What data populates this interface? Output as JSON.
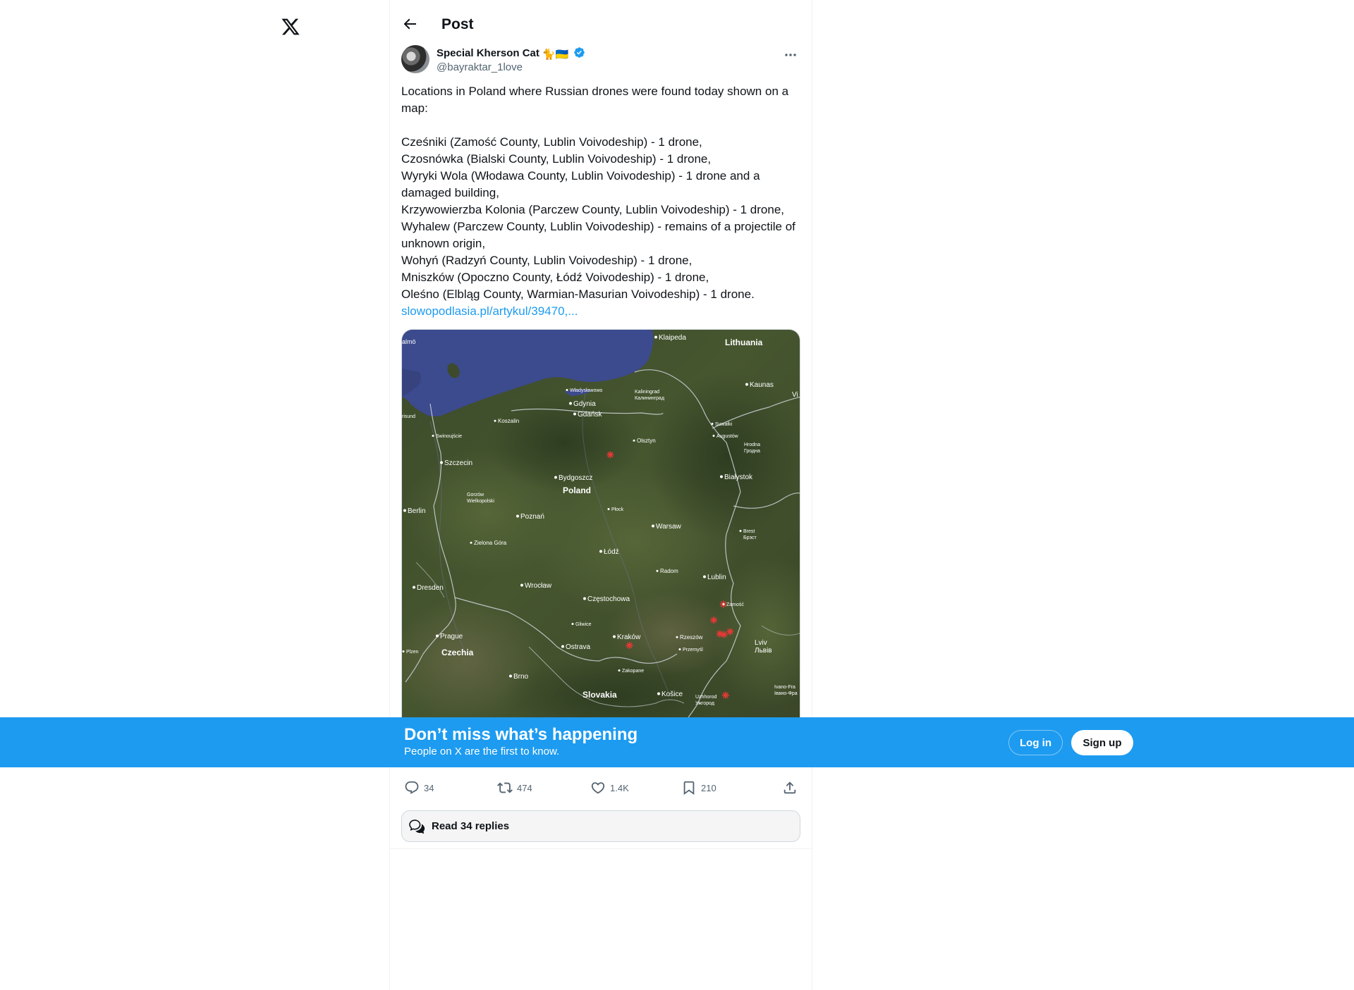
{
  "header": {
    "title": "Post"
  },
  "author": {
    "display_name": "Special Kherson Cat",
    "name_emoji": "🐈🇺🇦",
    "handle": "@bayraktar_1love",
    "verified": true
  },
  "tweet": {
    "text": "Locations in Poland where Russian drones were found today shown on a map:\n\nCześniki (Zamość County, Lublin Voivodeship) - 1 drone,\nCzosnówka (Bialski County, Lublin Voivodeship) - 1 drone,\nWyryki Wola (Włodawa County, Lublin Voivodeship) - 1 drone and a damaged building,\nKrzywowierzba Kolonia (Parczew County, Lublin Voivodeship) - 1 drone,\nWyhalew (Parczew County, Lublin Voivodeship) - remains of a projectile of unknown origin,\nWohyń (Radzyń County, Lublin Voivodeship) - 1 drone,\nMniszków (Opoczno County, Łódź Voivodeship) - 1 drone,\nOleśno (Elbląg County, Warmian-Masurian Voivodeship) - 1 drone.",
    "link": "slowopodlasia.pl/artykul/39470,..."
  },
  "map_labels": {
    "malmo": "almö",
    "klaipeda": "Klaipeda",
    "lithuania": "Lithuania",
    "kaunas": "Kaunas",
    "vilnius": "Vi",
    "wladyslawowo": "Władysławowo",
    "kaliningrad": "Kaliningrad",
    "kaliningrad_ru": "Калининград",
    "gdynia": "Gdynia",
    "gdansk": "Gdańsk",
    "trelleborg": "risund",
    "koszalin": "Koszalin",
    "suwalki": "Suwałki",
    "augustow": "Augustów",
    "olsztyn": "Olsztyn",
    "swinoujscie": "Swinoujście",
    "hrodna": "Hrodna",
    "hrodna_ru": "Гродна",
    "szczecin": "Szczecin",
    "bydgoszcz": "Bydgoszcz",
    "bialystok": "Białystok",
    "poland": "Poland",
    "gorzow": "Gorzów",
    "gorzow2": "Wielkopolski",
    "berlin": "Berlin",
    "plock": "Płock",
    "poznan": "Poznań",
    "warsaw": "Warsaw",
    "brest": "Brest",
    "brest_ru": "Брэст",
    "zielona": "Zielona Góra",
    "lodz": "Łódź",
    "radom": "Radom",
    "lublin": "Lublin",
    "dresden": "Dresden",
    "wroclaw": "Wrocław",
    "czestochowa": "Częstochowa",
    "zamosc": "Zamość",
    "gliwice": "Gliwice",
    "prague": "Prague",
    "krakow": "Kraków",
    "rzeszow": "Rzeszów",
    "lviv": "Lviv",
    "lviv_ua": "Львів",
    "przemysl": "Przemyśl",
    "plzen": "Plzen",
    "czechia": "Czechia",
    "ostrava": "Ostrava",
    "zakopane": "Zakopane",
    "brno": "Brno",
    "ivano": "Ivano-Fra",
    "ivano_ua": "Івано-Фра",
    "slovakia": "Slovakia",
    "kosice": "Košice",
    "uzhhorod": "Uzhhorod",
    "uzhhorod_ua": "Ужгород"
  },
  "map_markers": [
    {
      "name": "oleśno",
      "lon": 19.52,
      "lat": 54.05
    },
    {
      "name": "wohyń",
      "lon": 22.76,
      "lat": 51.76
    },
    {
      "name": "krzywowierzba",
      "lon": 22.95,
      "lat": 51.57
    },
    {
      "name": "wyhalew",
      "lon": 23.08,
      "lat": 51.56
    },
    {
      "name": "wyryki",
      "lon": 23.27,
      "lat": 51.6
    },
    {
      "name": "czosnówka",
      "lon": 23.06,
      "lat": 51.98
    },
    {
      "name": "cześniki",
      "lon": 23.13,
      "lat": 50.72
    },
    {
      "name": "mniszków",
      "lon": 20.12,
      "lat": 51.41
    }
  ],
  "actions": {
    "replies": "34",
    "reposts": "474",
    "likes": "1.4K",
    "bookmarks": "210"
  },
  "read_replies": "Read 34 replies",
  "banner": {
    "title": "Don’t miss what’s happening",
    "subtitle": "People on X are the first to know.",
    "login": "Log in",
    "signup": "Sign up"
  },
  "colors": {
    "accent": "#1d9bf0",
    "text": "#0f1419",
    "muted": "#536471",
    "marker": "#e53935"
  }
}
